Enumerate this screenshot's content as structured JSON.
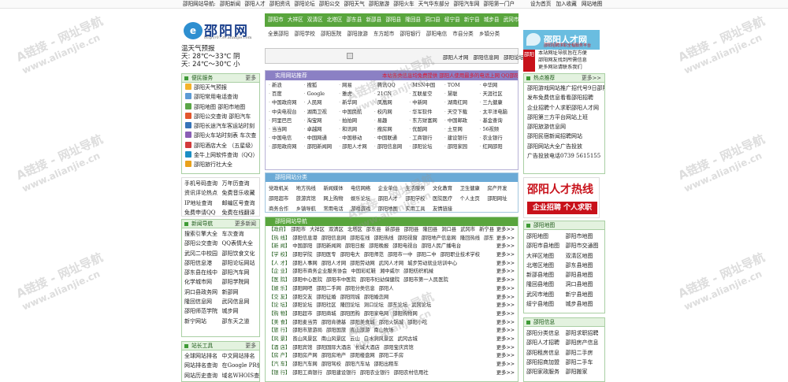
{
  "topbar": {
    "nav": [
      "邵阳网站导航:",
      "邵阳新闻",
      "邵阳人才",
      "邵阳资讯",
      "邵阳论坛",
      "邵阳公交",
      "邵阳天气",
      "邵阳旅游",
      "邵阳火车",
      "天气华东部分",
      "邵阳汽车网",
      "邵阳第一门户"
    ],
    "right": [
      "设为首页",
      "加入收藏",
      "网站地图"
    ]
  },
  "logo": {
    "mark": "e",
    "name": "邵阳网",
    "url": "http://0739.alianjie.com"
  },
  "weather": {
    "title": "温天气预报",
    "today": "天: 28℃～33℃ 阴",
    "tomorrow": "天: 24℃～30℃ 小"
  },
  "citybar": [
    "邵阳市",
    "大祥区",
    "双清区",
    "北塔区",
    "邵东县",
    "新邵县",
    "邵阳县",
    "隆回县",
    "洞口县",
    "绥宁县",
    "新宁县",
    "城步县",
    "武冈市"
  ],
  "subbar": [
    "全景邵阳",
    "邵阳学校",
    "邵阳医院",
    "邵阳旅游",
    "东方超市",
    "邵阳银行",
    "邵阳电信",
    "市县分类",
    "乡镇分类"
  ],
  "search": {
    "links": [
      "邵阳人才网",
      "邵阳信息网",
      "邵阳论坛"
    ]
  },
  "rightlogo": {
    "name": "邵阳人才网",
    "slogan": "邵阳招聘求职全程服务平台"
  },
  "adblock": {
    "ad": "邵阳",
    "lines": [
      "本站网址导航旨在方便",
      "邵阳网友找到所需信息",
      "更多网站请联系我们"
    ]
  },
  "banner": {
    "line1": "邵阳人才热线",
    "line2": "企业招聘 个人求职"
  },
  "left": {
    "service": {
      "title": "便民服务",
      "more": "更多",
      "items": [
        "邵阳天气预报",
        "邵阳常用电话查询",
        "邵阳地图 邵阳市地图",
        "邵阳公交查询 邵阳汽车",
        "邵阳长途汽车客运站时刻",
        "邵阳火车站时刻表 车次查",
        "邵阳酒店大全 （五星级）",
        "金牛上网软件查询（QQ）",
        "邵阳旅行社大全"
      ]
    },
    "tools": [
      "手机号码查询",
      "万年历查询",
      "资讯评论热点",
      "免费音乐收藏",
      "IP地址查询",
      "邮编区号查询",
      "免费申请QQ",
      "免费在线翻译"
    ],
    "news": {
      "title": "新闻导航",
      "more": "更多新闻",
      "items": [
        "搜索引擎大全",
        "车次查询",
        "邵阳公交查询",
        "QQ表情大全",
        "武冈二中校园",
        "邵阳饮食文化",
        "邵阳信息港",
        "邵阳论坛网站",
        "邵东县在线中",
        "邵阳汽车网",
        "化学城市网",
        "邵阳学院网",
        "洞口县政务网",
        "新邵网",
        "隆回信息网",
        "武冈信息网",
        "邵阳师范学院",
        "城步网",
        "新宁网站",
        "邵东天之道"
      ]
    },
    "station": {
      "title": "站长工具",
      "more": "更多",
      "items": [
        "全球网站排名",
        "中文网站排名",
        "网站排名查询",
        "在Google PR值",
        "网站历史查询",
        "域名WHOIS查询"
      ]
    }
  },
  "sites": {
    "title": "实用网站推荐",
    "notice": "本站各类信息均免费提供 邵阳人使用最多的电话上网 QQ邵阳聊天室",
    "cells": [
      "新浪",
      "搜狐",
      "网易",
      "腾讯QQ",
      "MSN中国",
      "TOM",
      "中华网",
      "百度",
      "Google",
      "雅虎",
      "21CN",
      "互联星空",
      "慧聪",
      "天涯社区",
      "中国政府网",
      "人民网",
      "新华网",
      "凤凰网",
      "中新网",
      "湖南红网",
      "三九健康",
      "中央电视台",
      "湖南卫视",
      "中国民航",
      "校内网",
      "华军软件",
      "天空下载",
      "太平洋电脑",
      "阿里巴巴",
      "淘宝网",
      "拍拍网",
      "易趣",
      "东方财富网",
      "中国邮政",
      "基金查询",
      "当当网",
      "卓越网",
      "和讯网",
      "搜房网",
      "优酷网",
      "土豆网",
      "56视频",
      "中国电信",
      "中国网通",
      "中国移动",
      "中国联通",
      "工商银行",
      "建设银行",
      "农业银行",
      "邵阳政府网",
      "邵阳新闻网",
      "邵阳人才网",
      "邵阳信息网",
      "邵阳论坛",
      "邵阳家园",
      "红网邵阳"
    ]
  },
  "cats": {
    "title": "邵阳网站分类",
    "cells": [
      "党政机关",
      "地方热线",
      "新闻媒体",
      "电信网络",
      "企业单位",
      "生活服务",
      "文化教育",
      "卫生健康",
      "房产开发",
      "邵阳超市",
      "旅游宾馆",
      "网上购物",
      "娱乐论坛",
      "邵阳人才",
      "邵阳学校",
      "医院医疗",
      "个人主页",
      "邵阳网址",
      "商务合作",
      "乡镇导航",
      "常用电话",
      "游戏游戏",
      "邵阳地图",
      "实用工具",
      "友情链接"
    ]
  },
  "dir": {
    "title": "邵阳网站导航",
    "more": "更多>>",
    "rows": [
      {
        "tag": "【政府】",
        "items": [
          "邵阳市",
          "大祥区",
          "双清区",
          "北塔区",
          "邵东县",
          "新邵县",
          "邵阳县",
          "隆回县",
          "洞口县",
          "武冈市",
          "新宁县"
        ]
      },
      {
        "tag": "【热 线】",
        "items": [
          "邵阳信息港",
          "邵阳信息网",
          "邵阳在线",
          "邵阳热线",
          "邵阳视窗",
          "邵阳地产信息网",
          "隆回热线",
          "邵东热线"
        ]
      },
      {
        "tag": "【新 闻】",
        "items": [
          "中国邵阳",
          "邵阳新闻网",
          "邵阳日报",
          "邵阳晚报",
          "邵阳电视台",
          "邵阳人民广播电台"
        ]
      },
      {
        "tag": "【学 校】",
        "items": [
          "邵阳学院",
          "邵阳医专",
          "邵阳电大",
          "邵阳师范",
          "邵阳市一中",
          "邵阳二中",
          "邵阳职业技术学校"
        ]
      },
      {
        "tag": "【人 才】",
        "items": [
          "邵阳人事网",
          "邵阳人才网",
          "邵阳劳动网",
          "武冈人才网",
          "城步劳动就业培训中心"
        ]
      },
      {
        "tag": "【企 业】",
        "items": [
          "邵阳市商务企业服务协会",
          "中国彩虹鞋",
          "湘中威尔",
          "邵阳纺织机械"
        ]
      },
      {
        "tag": "【医 院】",
        "items": [
          "邵阳中心医院",
          "邵阳市中医院",
          "邵阳市妇幼保健院",
          "邵阳市第一人民医院"
        ]
      },
      {
        "tag": "【娱 乐】",
        "items": [
          "邵阳网吧",
          "邵阳二手网",
          "邵阳分类信息",
          "邵阳人"
        ]
      },
      {
        "tag": "【交 友】",
        "items": [
          "邵阳交友",
          "邵阳征婚",
          "邵阳同城",
          "邵阳婚恋网"
        ]
      },
      {
        "tag": "【论 坛】",
        "items": [
          "邵阳论坛",
          "邵阳社区",
          "隆回论坛",
          "洞口论坛",
          "邵东论坛",
          "武冈论坛"
        ]
      },
      {
        "tag": "【购 物】",
        "items": [
          "邵阳超市",
          "邵阳商城",
          "邵阳团购",
          "邵阳家电网",
          "邵阳购物网"
        ]
      },
      {
        "tag": "【美 食】",
        "items": [
          "邵阳麦当劳",
          "邵阳肯德基",
          "邵阳美食城",
          "邵阳火锅城",
          "邵阳小吃"
        ]
      },
      {
        "tag": "【旅 行】",
        "items": [
          "邵阳市旅游局",
          "邵阳国旅",
          "崀山旅游",
          "南山牧场"
        ]
      },
      {
        "tag": "【风 景】",
        "items": [
          "崀山风景区",
          "南山风景区",
          "云山",
          "白水洞风景区",
          "武冈古城"
        ]
      },
      {
        "tag": "【酒 店】",
        "items": [
          "邵阳宾馆",
          "邵阳国际大酒店",
          "长城大酒店",
          "邵阳宝庆宾馆"
        ]
      },
      {
        "tag": "【房 产】",
        "items": [
          "邵阳房产网",
          "邵阳房地产",
          "邵阳楼盘网",
          "邵阳二手房"
        ]
      },
      {
        "tag": "【汽 车】",
        "items": [
          "邵阳汽车网",
          "邵阳驾校",
          "邵阳汽车站",
          "邵阳出租车"
        ]
      },
      {
        "tag": "【银 行】",
        "items": [
          "邵阳工商银行",
          "邵阳建设银行",
          "邵阳农业银行",
          "邵阳农村信用社"
        ]
      }
    ]
  },
  "right": {
    "hot": {
      "title": "热点推荐",
      "more": "更多>>",
      "items": [
        "邵阳游戏网站推广招代号9日邵阳",
        "发布免费信息看看邵阳招聘",
        "企业招聘个人求职邵阳人才网",
        "邵阳第三方平台网站上班",
        "邵阳旅游信息网",
        "邵阳民宿新闻招聘网站",
        "邵阳网站大全广告投放",
        "广告投放电话0739 5615155"
      ]
    },
    "map": {
      "title": "邵阳地图",
      "more": "",
      "items": [
        "邵阳地图",
        "邵阳市地图",
        "邵阳市县地图",
        "邵阳市交通图",
        "大祥区地图",
        "双清区地图",
        "北塔区地图",
        "邵东县地图",
        "新邵县地图",
        "邵阳县地图",
        "隆回县地图",
        "洞口县地图",
        "武冈市地图",
        "新宁县地图",
        "绥宁县地图",
        "城步县地图"
      ]
    },
    "info": {
      "title": "邵阳信息",
      "more": "",
      "items": [
        "邵阳分类信息",
        "邵阳求职招聘",
        "邵阳人才招聘",
        "邵阳房产信息",
        "邵阳租房信息",
        "邵阳二手房",
        "邵阳招商加盟",
        "邵阳二手车",
        "邵阳家政服务",
        "邵阳搬家"
      ]
    }
  },
  "watermarks": [
    "A链接 - 网址导航",
    "www.alianjie.cn"
  ]
}
